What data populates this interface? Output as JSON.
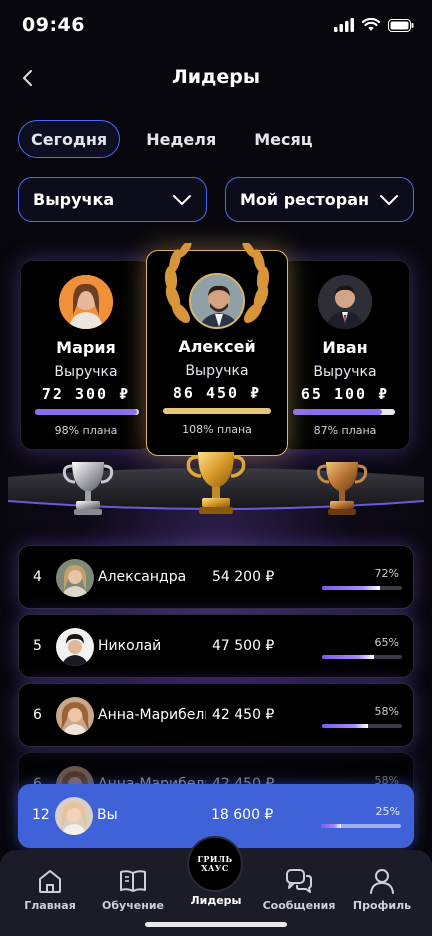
{
  "status_bar": {
    "time": "09:46"
  },
  "header": {
    "title": "Лидеры"
  },
  "tabs": [
    {
      "label": "Сегодня",
      "active": true
    },
    {
      "label": "Неделя",
      "active": false
    },
    {
      "label": "Месяц",
      "active": false
    }
  ],
  "filters": {
    "metric": "Выручка",
    "scope": "Мой ресторан"
  },
  "podium": {
    "first": {
      "name": "Алексей",
      "metric": "Выручка",
      "value": "86 450 ₽",
      "plan": "108% плана",
      "progress": 1.0,
      "bar_color": "#e9c57a"
    },
    "second": {
      "name": "Мария",
      "metric": "Выручка",
      "value": "72 300 ₽",
      "plan": "98% плана",
      "progress": 0.98,
      "bar_color": "#8b6cf0"
    },
    "third": {
      "name": "Иван",
      "metric": "Выручка",
      "value": "65 100 ₽",
      "plan": "87% плана",
      "progress": 0.87,
      "bar_color": "#8b6cf0"
    }
  },
  "leaderboard": [
    {
      "rank": "4",
      "name": "Александра",
      "value": "54 200 ₽",
      "percent": "72%",
      "progress": 0.72
    },
    {
      "rank": "5",
      "name": "Николай",
      "value": "47 500 ₽",
      "percent": "65%",
      "progress": 0.65
    },
    {
      "rank": "6",
      "name": "Анна-Марибель",
      "value": "42 450 ₽",
      "percent": "58%",
      "progress": 0.58
    },
    {
      "rank": "6",
      "name": "Анна-Марибель",
      "value": "42 450 ₽",
      "percent": "58%",
      "progress": 0.58
    }
  ],
  "current_user": {
    "rank": "12",
    "name": "Вы",
    "value": "18 600 ₽",
    "percent": "25%",
    "progress": 0.25
  },
  "bottom_nav": {
    "home": "Главная",
    "learning": "Обучение",
    "leaders": "Лидеры",
    "messages": "Сообщения",
    "profile": "Профиль",
    "logo_line1": "ГРИЛЬ",
    "logo_line2": "ХАУС"
  },
  "colors": {
    "accent": "#4b6cf0",
    "gold": "#e9c57a",
    "purple": "#8b6cf0",
    "you_row": "#3f62d8"
  }
}
